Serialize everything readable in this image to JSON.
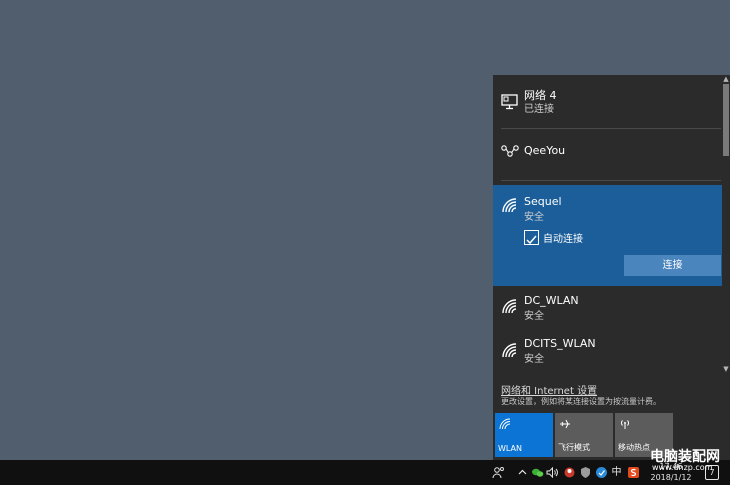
{
  "networks": [
    {
      "name": "网络  4",
      "status": "已连接",
      "icon": "ethernet-icon"
    },
    {
      "name": "QeeYou",
      "status": "",
      "icon": "vpn-icon"
    },
    {
      "name": "Sequel",
      "status": "安全",
      "icon": "wifi-icon",
      "selected": true,
      "auto_connect_label": "自动连接",
      "auto_connect_checked": true,
      "connect_label": "连接"
    },
    {
      "name": "DC_WLAN",
      "status": "安全",
      "icon": "wifi-icon"
    },
    {
      "name": "DCITS_WLAN",
      "status": "安全",
      "icon": "wifi-icon"
    }
  ],
  "settings": {
    "link": "网络和 Internet 设置",
    "description": "更改设置，例如将某连接设置为按流量计费。"
  },
  "quick_actions": [
    {
      "label": "WLAN",
      "active": true,
      "icon": "wifi-icon"
    },
    {
      "label": "飞行模式",
      "active": false,
      "icon": "airplane-icon"
    },
    {
      "label": "移动热点",
      "active": false,
      "icon": "hotspot-icon"
    }
  ],
  "taskbar": {
    "ime": "中",
    "time": "17:46",
    "date": "2018/1/12",
    "notifications": "7"
  },
  "watermark": {
    "title": "电脑装配网",
    "url": "www.dnzp.com"
  },
  "colors": {
    "desktop": "#515e6d",
    "flyout": "#2b2b2b",
    "selected": "#1b5e9a",
    "accent": "#0c74d4",
    "taskbar": "#101010"
  }
}
